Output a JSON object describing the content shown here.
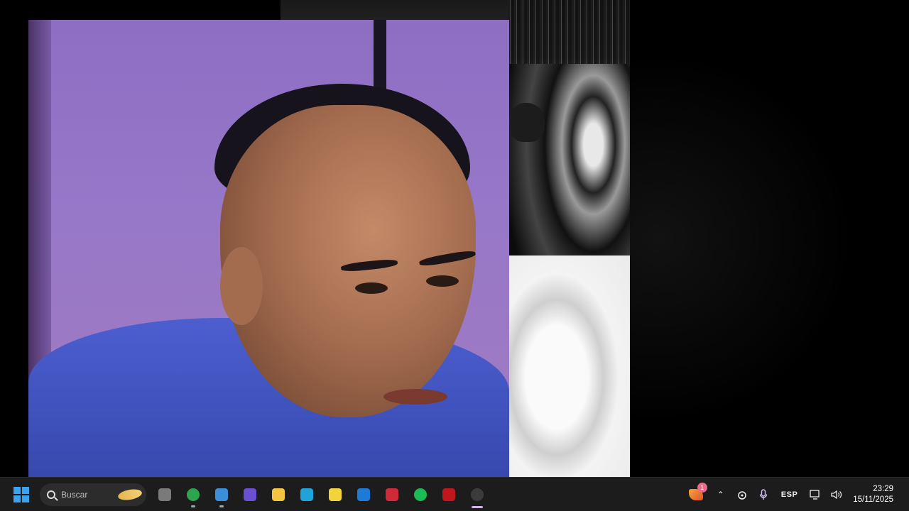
{
  "taskbar": {
    "search": {
      "placeholder": "Buscar"
    },
    "pinned_apps": [
      {
        "name": "file-explorer",
        "color": "#7a7a7a"
      },
      {
        "name": "chrome",
        "color": "#2da44e"
      },
      {
        "name": "edge",
        "color": "#3a8fd8"
      },
      {
        "name": "app-purple",
        "color": "#6a4fd0"
      },
      {
        "name": "folder",
        "color": "#f3c442"
      },
      {
        "name": "edge-dev",
        "color": "#1fa3d9"
      },
      {
        "name": "sticky-notes",
        "color": "#f2d33a"
      },
      {
        "name": "mail",
        "color": "#1d7ad6"
      },
      {
        "name": "ide",
        "color": "#d02a3a"
      },
      {
        "name": "spotify",
        "color": "#1db954"
      },
      {
        "name": "red-app",
        "color": "#c0161c"
      },
      {
        "name": "obs-studio",
        "color": "#3b3b3b"
      }
    ],
    "tray": {
      "notification_count": "1",
      "language": "ESP",
      "time": "23:29",
      "date": "15/11/2025"
    }
  }
}
